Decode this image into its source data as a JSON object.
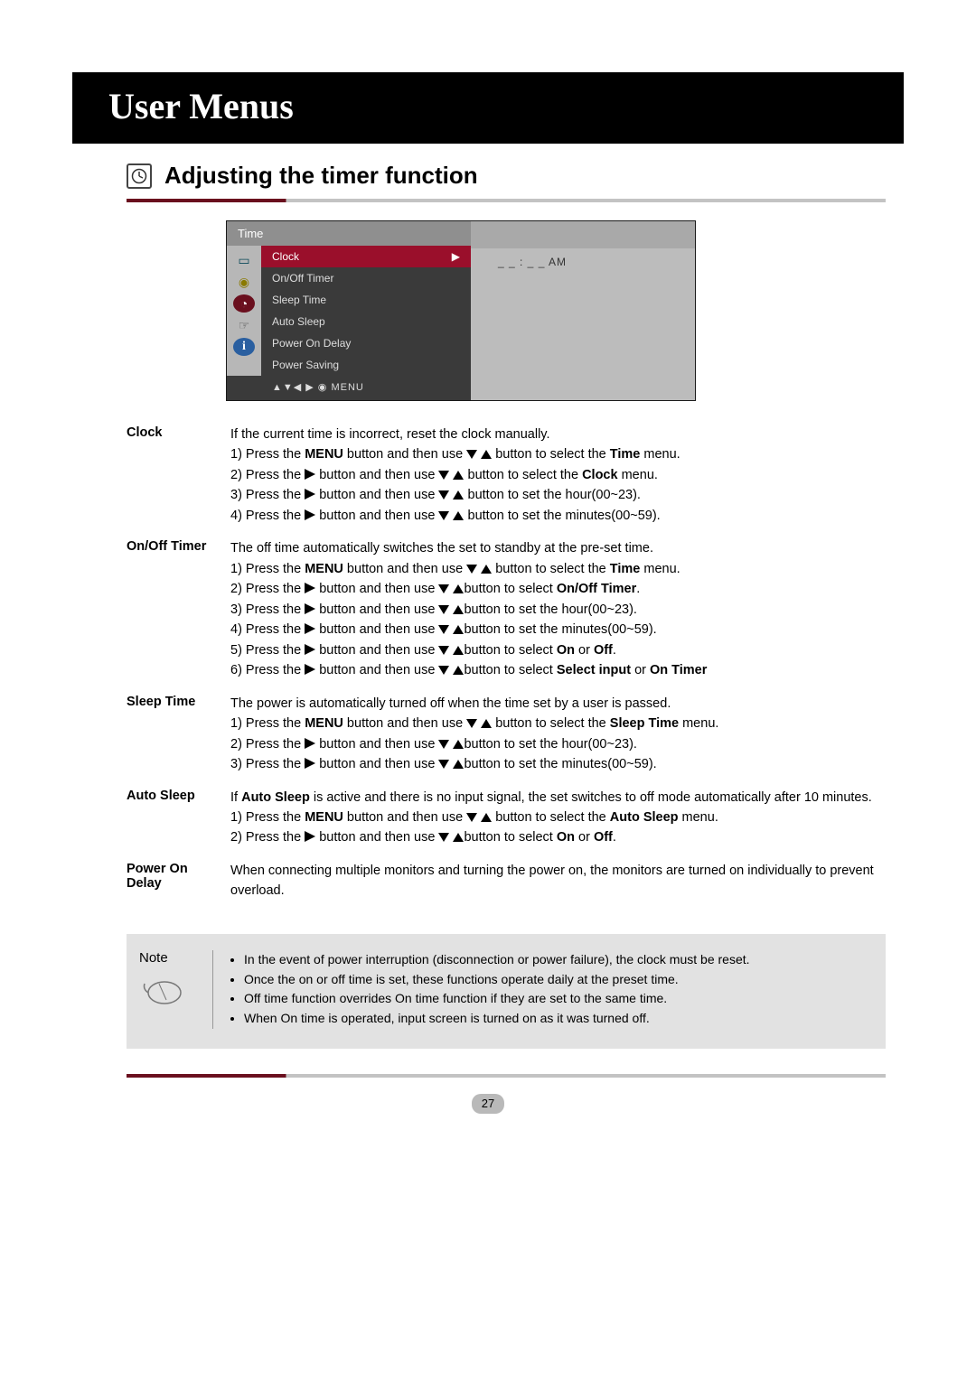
{
  "banner": "User Menus",
  "heading": "Adjusting the timer function",
  "osd": {
    "title": "Time",
    "items": [
      "Clock",
      "On/Off Timer",
      "Sleep Time",
      "Auto Sleep",
      "Power On Delay",
      "Power Saving"
    ],
    "hint": "▲▼◀ ▶ ◉ MENU",
    "rightValue": "_ _ : _ _   AM",
    "arrow": "▶"
  },
  "sections": {
    "clock": {
      "label": "Clock",
      "intro": "If the current time is incorrect, reset the clock manually.",
      "s1a": "1) Press the ",
      "s1b": "MENU",
      "s1c": " button and then use ",
      "s1d": " button to select the ",
      "s1e": "Time",
      "s1f": " menu.",
      "s2a": "2) Press the ",
      "s2b": " button and then use ",
      "s2c": " button to select the ",
      "s2d": "Clock",
      "s2e": " menu.",
      "s3a": "3) Press the ",
      "s3b": " button and then use ",
      "s3c": " button to set the hour(00~23).",
      "s4a": "4) Press the ",
      "s4b": " button and then use ",
      "s4c": " button to set the minutes(00~59)."
    },
    "onoff": {
      "label": "On/Off Timer",
      "intro": "The off time automatically switches the set to standby at the pre-set time.",
      "s1a": "1) Press the ",
      "s1b": "MENU",
      "s1c": " button and then use ",
      "s1d": " button to select the ",
      "s1e": "Time",
      "s1f": " menu.",
      "s2a": "2) Press the ",
      "s2b": " button and then use ",
      "s2c": "button to select ",
      "s2d": "On/Off Timer",
      "s2e": ".",
      "s3a": "3) Press the ",
      "s3b": " button and then use ",
      "s3c": "button to set the hour(00~23).",
      "s4a": "4) Press the ",
      "s4b": " button and then use ",
      "s4c": "button to set the minutes(00~59).",
      "s5a": "5) Press the ",
      "s5b": " button and then use ",
      "s5c": "button to select ",
      "s5d": "On",
      "s5e": " or ",
      "s5f": "Off",
      "s5g": ".",
      "s6a": "6) Press the ",
      "s6b": " button and then use ",
      "s6c": "button to select ",
      "s6d": "Select input",
      "s6e": " or ",
      "s6f": "On Timer"
    },
    "sleep": {
      "label": "Sleep Time",
      "intro": "The power is automatically turned off when the time set by a user is passed.",
      "s1a": "1) Press the ",
      "s1b": "MENU",
      "s1c": " button and then use ",
      "s1d": " button to select the ",
      "s1e": "Sleep Time",
      "s1f": " menu.",
      "s2a": "2) Press the ",
      "s2b": " button and then use ",
      "s2c": "button to set the hour(00~23).",
      "s3a": "3) Press the ",
      "s3b": " button and then use ",
      "s3c": "button to set the minutes(00~59)."
    },
    "auto": {
      "label": "Auto Sleep",
      "introA": "If ",
      "introB": "Auto Sleep",
      "introC": " is active and there is no input signal, the set  switches to off mode automatically after 10 minutes.",
      "s1a": "1) Press the ",
      "s1b": "MENU",
      "s1c": " button and then use ",
      "s1d": " button to select the ",
      "s1e": "Auto Sleep",
      "s1f": " menu.",
      "s2a": "2) Press the ",
      "s2b": " button and then use ",
      "s2c": "button to select ",
      "s2d": "On",
      "s2e": " or ",
      "s2f": "Off",
      "s2g": "."
    },
    "pod": {
      "label": "Power On Delay",
      "intro": "When connecting multiple monitors and turning the power on, the monitors are turned on individually to prevent overload."
    }
  },
  "note": {
    "title": "Note",
    "items": [
      "In the event of power interruption (disconnection or power failure), the clock must be reset.",
      "Once the on or off time is set, these functions operate daily at the preset time.",
      "Off time function overrides On time function if they are set to the same time.",
      "When On time is operated, input screen is turned on as it was turned off."
    ]
  },
  "pageNumber": "27"
}
